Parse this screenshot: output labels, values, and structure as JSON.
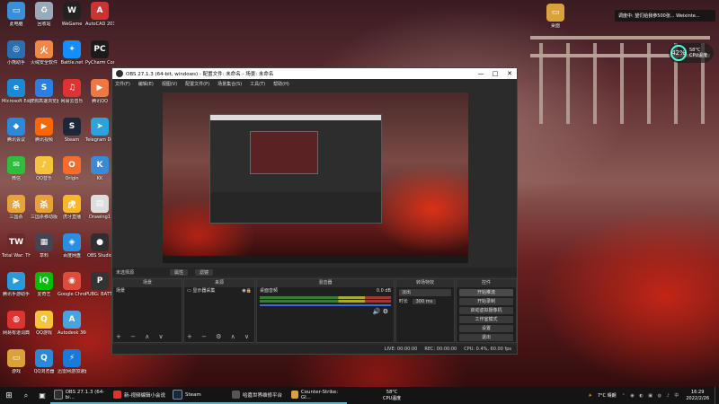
{
  "desktop": {
    "icons": [
      {
        "label": "此电脑",
        "color": "#3a8fd6",
        "glyph": "▭",
        "col": 0,
        "row": 0
      },
      {
        "label": "回收站",
        "color": "#9ab",
        "glyph": "♻",
        "col": 1,
        "row": 0
      },
      {
        "label": "WeGame",
        "color": "#222",
        "glyph": "W",
        "col": 2,
        "row": 0
      },
      {
        "label": "AutoCAD 2014 - 简体",
        "color": "#c33",
        "glyph": "A",
        "col": 3,
        "row": 0
      },
      {
        "label": "小熊助手",
        "color": "#2a6fb0",
        "glyph": "◎",
        "col": 0,
        "row": 1
      },
      {
        "label": "火绒安全软件",
        "color": "#e84",
        "glyph": "火",
        "col": 1,
        "row": 1
      },
      {
        "label": "Battle.net",
        "color": "#148eff",
        "glyph": "✦",
        "col": 2,
        "row": 1
      },
      {
        "label": "PyCharm Community",
        "color": "#1b1b1b",
        "glyph": "PC",
        "col": 3,
        "row": 1
      },
      {
        "label": "Microsoft Edge",
        "color": "#1a8ad4",
        "glyph": "e",
        "col": 0,
        "row": 2
      },
      {
        "label": "搜狗高速浏览器",
        "color": "#2a7fe0",
        "glyph": "S",
        "col": 1,
        "row": 2
      },
      {
        "label": "网易云音乐",
        "color": "#d33",
        "glyph": "♫",
        "col": 2,
        "row": 2
      },
      {
        "label": "腾讯QQ",
        "color": "#e74",
        "glyph": "▶",
        "col": 3,
        "row": 2
      },
      {
        "label": "腾讯会议",
        "color": "#2a8ad8",
        "glyph": "◆",
        "col": 0,
        "row": 3
      },
      {
        "label": "腾讯视频",
        "color": "#f60",
        "glyph": "▶",
        "col": 1,
        "row": 3
      },
      {
        "label": "Steam",
        "color": "#1b2838",
        "glyph": "S",
        "col": 2,
        "row": 3
      },
      {
        "label": "Telegram Desktop",
        "color": "#2aa3df",
        "glyph": "➤",
        "col": 3,
        "row": 3
      },
      {
        "label": "微信",
        "color": "#2dbe3c",
        "glyph": "✉",
        "col": 0,
        "row": 4
      },
      {
        "label": "QQ音乐",
        "color": "#f6c43c",
        "glyph": "♪",
        "col": 1,
        "row": 4
      },
      {
        "label": "Origin",
        "color": "#f56c2d",
        "glyph": "O",
        "col": 2,
        "row": 4
      },
      {
        "label": "KK",
        "color": "#3a8ad8",
        "glyph": "K",
        "col": 3,
        "row": 4
      },
      {
        "label": "三国杀",
        "color": "#e8a23a",
        "glyph": "杀",
        "col": 0,
        "row": 5
      },
      {
        "label": "三国杀移动版",
        "color": "#e8a23a",
        "glyph": "杀",
        "col": 1,
        "row": 5
      },
      {
        "label": "虎牙直播",
        "color": "#f8b62b",
        "glyph": "虎",
        "col": 2,
        "row": 5
      },
      {
        "label": "Drawing1",
        "color": "#ddd",
        "glyph": "▤",
        "col": 3,
        "row": 5
      },
      {
        "label": "Total War: THREE KI...",
        "color": "#6a2a2a",
        "glyph": "TW",
        "col": 0,
        "row": 6
      },
      {
        "label": "草料",
        "color": "#445",
        "glyph": "▦",
        "col": 1,
        "row": 6
      },
      {
        "label": "百度网盘",
        "color": "#2a8fe0",
        "glyph": "◈",
        "col": 2,
        "row": 6
      },
      {
        "label": "OBS Studio",
        "color": "#302e31",
        "glyph": "●",
        "col": 3,
        "row": 6
      },
      {
        "label": "腾讯手游助手",
        "color": "#2a9ad8",
        "glyph": "▶",
        "col": 0,
        "row": 7
      },
      {
        "label": "爱奇艺",
        "color": "#00be06",
        "glyph": "iQ",
        "col": 1,
        "row": 7
      },
      {
        "label": "Google Chrome",
        "color": "#dd4b39",
        "glyph": "◉",
        "col": 2,
        "row": 7
      },
      {
        "label": "PUBG: BATTLEGR...",
        "color": "#333",
        "glyph": "P",
        "col": 3,
        "row": 7
      },
      {
        "label": "网易有道词典",
        "color": "#d33",
        "glyph": "◍",
        "col": 0,
        "row": 8
      },
      {
        "label": "QQ游戏",
        "color": "#f6c43c",
        "glyph": "Q",
        "col": 1,
        "row": 8
      },
      {
        "label": "Autodesk 360",
        "color": "#4aa3df",
        "glyph": "A",
        "col": 2,
        "row": 8
      },
      {
        "label": "游戏",
        "color": "#d9a23a",
        "glyph": "▭",
        "col": 0,
        "row": 9
      },
      {
        "label": "QQ浏览器",
        "color": "#2a8ad8",
        "glyph": "Q",
        "col": 1,
        "row": 9
      },
      {
        "label": "迅雷网游加速器",
        "color": "#1a7ad8",
        "glyph": "⚡",
        "col": 2,
        "row": 9
      }
    ],
    "right_icon": {
      "label": "桌面",
      "color": "#d9a23a",
      "glyph": "▭"
    }
  },
  "notification": {
    "text": "调度中: 望们给我参500张...   Weixinte..."
  },
  "temperature": {
    "value": "42",
    "unit": "%",
    "label_top": "58°C",
    "label_bottom": "CPU温度"
  },
  "obs": {
    "title": "OBS 27.1.3 (64-bit, windows) - 配置文件: 未命名 - 场景: 未命名",
    "window_controls": {
      "minimize": "—",
      "maximize": "□",
      "close": "✕"
    },
    "menu": [
      "文件(F)",
      "编辑(E)",
      "视图(V)",
      "配置文件(P)",
      "场景集合(S)",
      "工具(T)",
      "帮助(H)"
    ],
    "scene_bar": {
      "label": "未选择源",
      "btn_props": "属性",
      "btn_filters": "滤镜"
    },
    "docks": {
      "scenes": {
        "header": "场景",
        "item": "场景"
      },
      "sources": {
        "header": "来源",
        "item": "显示器采集"
      },
      "mixer": {
        "header": "混音器",
        "channel": "桌面音频",
        "level": "0.0 dB"
      },
      "transitions": {
        "header": "转场特效",
        "type": "淡出",
        "duration_label": "时长",
        "duration": "300 ms"
      },
      "controls": {
        "header": "控件",
        "buttons": [
          "开始推流",
          "开始录制",
          "启动虚拟摄像机",
          "工作室模式",
          "设置",
          "退出"
        ]
      }
    },
    "dock_toolbar": "+ − ∧ ∨",
    "dock_toolbar_sources": "+ − ⚙ ∧ ∨",
    "status": {
      "live": "LIVE: 00:00:00",
      "rec": "REC: 00:00:00",
      "cpu": "CPU: 0.4%, 60.00 fps"
    }
  },
  "taskbar": {
    "apps": [
      {
        "label": "OBS 27.1.3 (64-bi...",
        "color": "#302e31"
      },
      {
        "label": "新-视频编辑小会说",
        "color": "#d33"
      },
      {
        "label": "Steam",
        "color": "#1b2838"
      },
      {
        "label": "哈嘉世界维修平台",
        "color": "#555"
      },
      {
        "label": "Counter-Strike: Gl...",
        "color": "#d9a23a"
      }
    ],
    "cpu_temp_top": "58°C",
    "cpu_temp_bottom": "CPU温度",
    "weather": "7°C 晴朗",
    "time": "16:29",
    "date": "2022/2/26"
  }
}
